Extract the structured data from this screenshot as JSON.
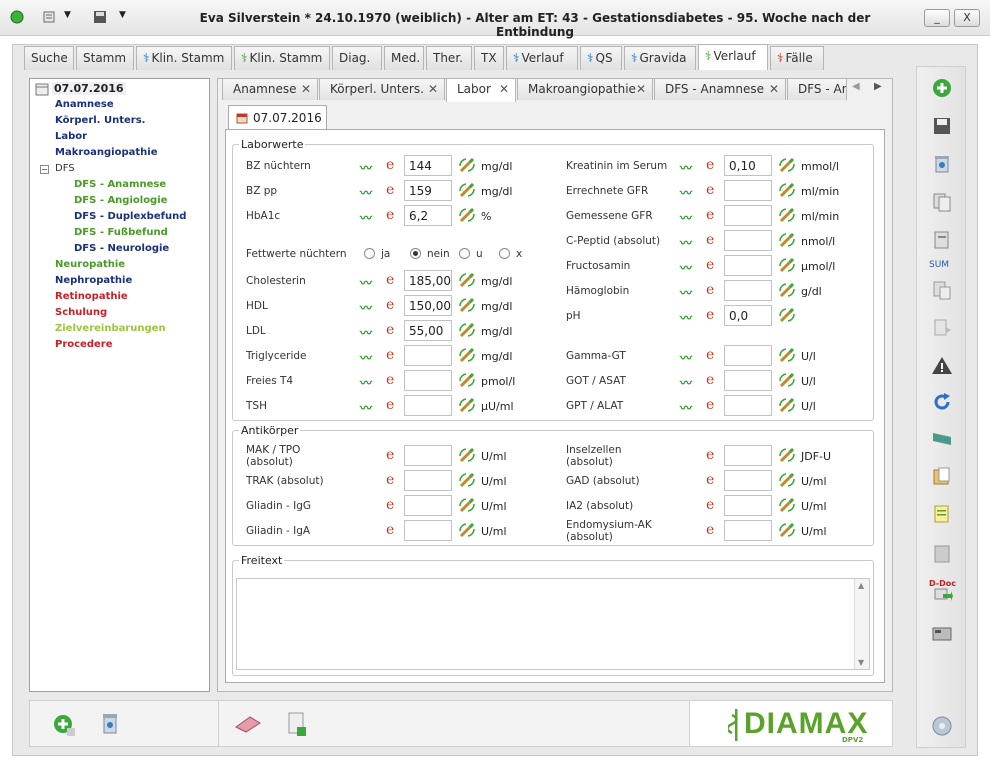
{
  "window": {
    "title": "Eva Silverstein  * 24.10.1970 (weiblich) - Alter am ET: 43 - Gestationsdiabetes - 95. Woche nach der Entbindung",
    "min_label": "_",
    "close_label": "X"
  },
  "main_tabs": [
    "Suche",
    "Stamm",
    "Klin. Stamm",
    "Klin. Stamm",
    "Diag.",
    "Med.",
    "Ther.",
    "TX",
    "Verlauf",
    "QS",
    "Gravida",
    "Verlauf",
    "Fälle"
  ],
  "tree": {
    "date": "07.07.2016",
    "items": [
      "Anamnese",
      "Körperl. Unters.",
      "Labor",
      "Makroangiopathie",
      "DFS",
      "DFS - Anamnese",
      "DFS - Angiologie",
      "DFS - Duplexbefund",
      "DFS - Fußbefund",
      "DFS - Neurologie",
      "Neuropathie",
      "Nephropathie",
      "Retinopathie",
      "Schulung",
      "Zielvereinbarungen",
      "Procedere"
    ]
  },
  "sub_tabs": [
    "Anamnese",
    "Körperl. Unters.",
    "Labor",
    "Makroangiopathie",
    "DFS - Anamnese",
    "DFS - An"
  ],
  "date_tab": "07.07.2016",
  "laborwerte": {
    "legend": "Laborwerte",
    "left": [
      {
        "label": "BZ nüchtern",
        "value": "144",
        "unit": "mg/dl"
      },
      {
        "label": "BZ pp",
        "value": "159",
        "unit": "mg/dl"
      },
      {
        "label": "HbA1c",
        "value": "6,2",
        "unit": "%"
      },
      {
        "label": "Cholesterin",
        "value": "185,00",
        "unit": "mg/dl"
      },
      {
        "label": "HDL",
        "value": "150,00",
        "unit": "mg/dl"
      },
      {
        "label": "LDL",
        "value": "55,00",
        "unit": "mg/dl"
      },
      {
        "label": "Triglyceride",
        "value": "",
        "unit": "mg/dl"
      },
      {
        "label": "Freies T4",
        "value": "",
        "unit": "pmol/l"
      },
      {
        "label": "TSH",
        "value": "",
        "unit": "µU/ml"
      }
    ],
    "fett": {
      "label": "Fettwerte nüchtern",
      "options": [
        "ja",
        "nein",
        "u",
        "x"
      ],
      "selected": "nein"
    },
    "right": [
      {
        "label": "Kreatinin im Serum",
        "value": "0,10",
        "unit": "mmol/l"
      },
      {
        "label": "Errechnete GFR",
        "value": "",
        "unit": "ml/min"
      },
      {
        "label": "Gemessene GFR",
        "value": "",
        "unit": "ml/min"
      },
      {
        "label": "C-Peptid (absolut)",
        "value": "",
        "unit": "nmol/l"
      },
      {
        "label": "Fructosamin",
        "value": "",
        "unit": "µmol/l"
      },
      {
        "label": "Hämoglobin",
        "value": "",
        "unit": "g/dl"
      },
      {
        "label": "pH",
        "value": "0,0",
        "unit": ""
      },
      {
        "label": "Gamma-GT",
        "value": "",
        "unit": "U/l"
      },
      {
        "label": "GOT / ASAT",
        "value": "",
        "unit": "U/l"
      },
      {
        "label": "GPT / ALAT",
        "value": "",
        "unit": "U/l"
      }
    ]
  },
  "antikoerper": {
    "legend": "Antikörper",
    "left": [
      {
        "label": "MAK / TPO",
        "label2": "(absolut)",
        "unit": "U/ml",
        "value": ""
      },
      {
        "label": "TRAK (absolut)",
        "label2": "",
        "unit": "U/ml",
        "value": ""
      },
      {
        "label": "Gliadin - IgG",
        "label2": "",
        "unit": "U/ml",
        "value": ""
      },
      {
        "label": "Gliadin - IgA",
        "label2": "",
        "unit": "U/ml",
        "value": ""
      }
    ],
    "right": [
      {
        "label": "Inselzellen",
        "label2": "(absolut)",
        "unit": "JDF-U",
        "value": ""
      },
      {
        "label": "GAD (absolut)",
        "label2": "",
        "unit": "U/ml",
        "value": ""
      },
      {
        "label": "IA2 (absolut)",
        "label2": "",
        "unit": "U/ml",
        "value": ""
      },
      {
        "label": "Endomysium-AK",
        "label2": "(absolut)",
        "unit": "U/ml",
        "value": ""
      }
    ]
  },
  "freitext": {
    "legend": "Freitext",
    "value": ""
  },
  "right_toolbar": {
    "sum_label": "SUM",
    "ddoc_label": "D-Doc"
  },
  "logo": {
    "text": "DIAMAX",
    "sub": "DPV2"
  },
  "colors": {
    "accent_green": "#4a9a28",
    "tree_blue": "#1b2f7c",
    "tree_red": "#c8202a",
    "logo_green": "#5aa32a"
  }
}
